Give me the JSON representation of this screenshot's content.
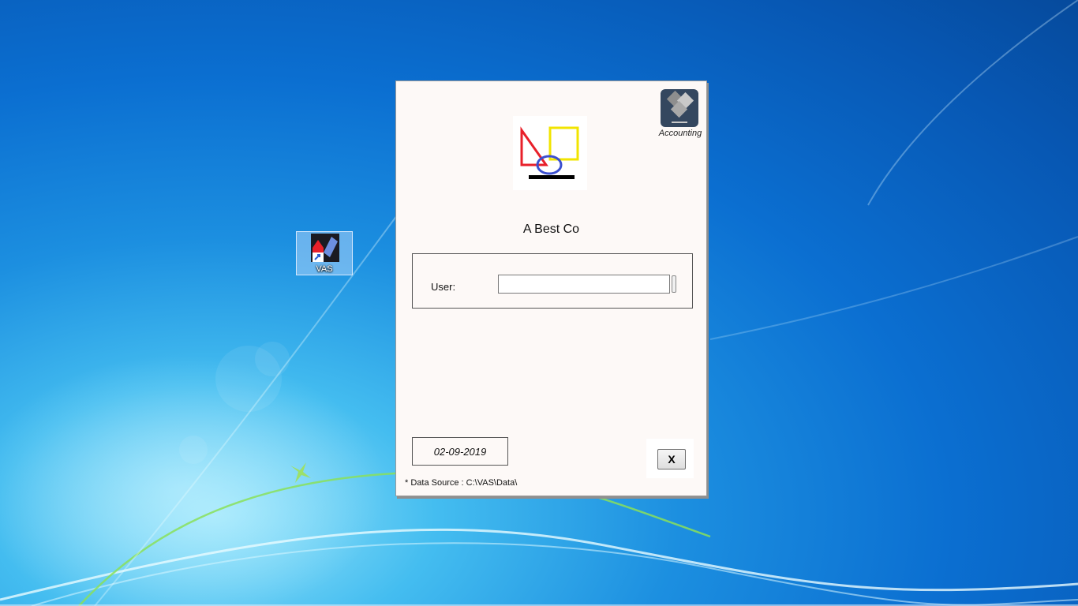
{
  "desktop": {
    "shortcut": {
      "label": "VAS",
      "icon": "vas-app-icon"
    }
  },
  "window": {
    "company_name": "A Best Co",
    "logo_icon": "company-logo-icon",
    "badge": {
      "icon": "accounting-app-icon",
      "caption": "Accounting"
    },
    "user_field": {
      "label": "User:",
      "value": "",
      "placeholder": ""
    },
    "date": "02-09-2019",
    "close_label": "X",
    "data_source": "* Data Source : C:\\VAS\\Data\\"
  },
  "colors": {
    "window_bg": "#fdf9f7",
    "accounting_tile": "#34475f",
    "logo_red": "#e8202a",
    "logo_yellow": "#f2e400",
    "logo_blue": "#3a4fd0"
  }
}
